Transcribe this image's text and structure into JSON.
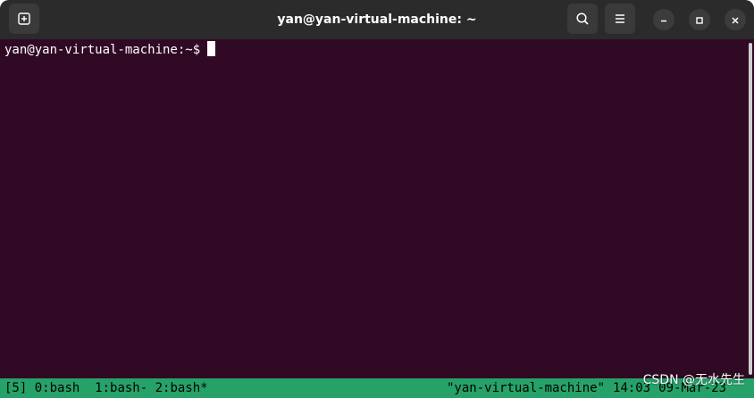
{
  "window": {
    "title": "yan@yan-virtual-machine: ~",
    "new_tab_icon": "new-tab-icon",
    "search_icon": "search-icon",
    "menu_icon": "hamburger-menu-icon",
    "minimize_icon": "minimize-icon",
    "maximize_icon": "maximize-icon",
    "close_icon": "close-icon"
  },
  "terminal": {
    "prompt": "yan@yan-virtual-machine:~$",
    "background": "#300a24",
    "foreground": "#ffffff"
  },
  "tmux_status": {
    "session": "[5]",
    "windows": "0:bash  1:bash- 2:bash*",
    "host": "\"yan-virtual-machine\"",
    "time": "14:03",
    "date": "09-Mar-23",
    "color": "#26a269"
  },
  "watermark": {
    "text": "CSDN @无水先生"
  }
}
